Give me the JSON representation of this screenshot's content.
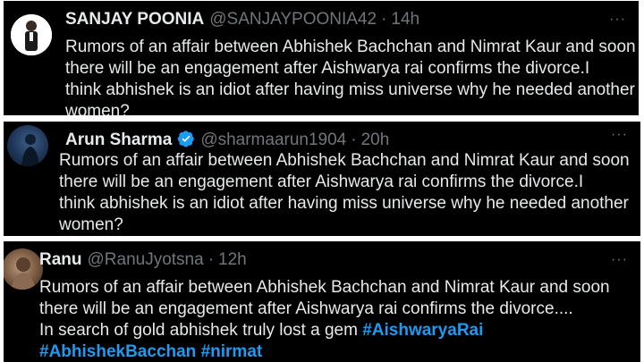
{
  "tweets": [
    {
      "name": "SANJAY POONIA",
      "handle": "@SANJAYPOONIA42",
      "time": "14h",
      "more": "···",
      "lines": [
        "Rumors of an affair between Abhishek Bachchan and Nimrat Kaur and soon",
        "there will be an engagement after  Aishwarya rai confirms the divorce.I",
        "think abhishek is an idiot after having miss universe why he needed another",
        "women?"
      ]
    },
    {
      "name": "Arun Sharma",
      "verified": true,
      "handle": "@sharmaarun1904",
      "time": "20h",
      "more": "···",
      "lines": [
        "Rumors of an affair between Abhishek Bachchan and Nimrat Kaur and soon",
        "there will be an engagement after  Aishwarya rai confirms the divorce.I",
        "think abhishek is an idiot after having miss universe why he needed another",
        "women?"
      ]
    },
    {
      "name": "Ranu",
      "handle": "@RanuJyotsna",
      "time": "12h",
      "more": "···",
      "lines": [
        "Rumors of an affair between Abhishek Bachchan and Nimrat Kaur and soon",
        "there will be an engagement after  Aishwarya rai confirms the divorce....",
        "In search of gold abhishek truly lost a gem"
      ],
      "hashtags": [
        "#AishwaryaRai",
        "#AbhishekBacchan",
        "#nirmat"
      ]
    }
  ],
  "separator": "·",
  "colors": {
    "background": "#000000",
    "text": "#e7e9ea",
    "muted": "#71767b",
    "link": "#1d9bf0",
    "verified": "#1d9bf0"
  }
}
